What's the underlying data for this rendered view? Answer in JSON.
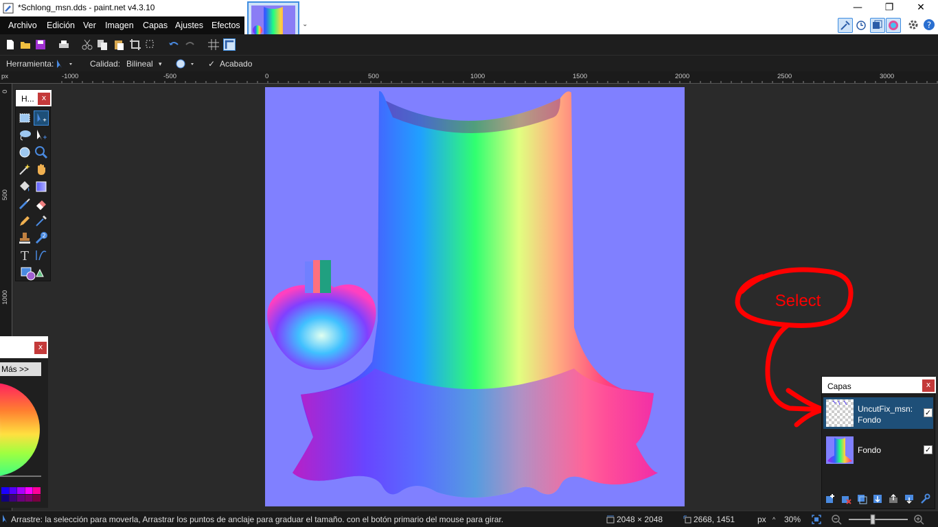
{
  "window": {
    "title": "*Schlong_msn.dds - paint.net v4.3.10",
    "minimize_glyph": "—",
    "maximize_glyph": "❐",
    "close_glyph": "✕"
  },
  "menu": {
    "items": [
      "Archivo",
      "Edición",
      "Ver",
      "Imagen",
      "Capas",
      "Ajustes",
      "Efectos"
    ]
  },
  "toolbar_options": {
    "tool_label": "Herramienta:",
    "quality_label": "Calidad:",
    "quality_value": "Bilineal",
    "finish_label": "Acabado"
  },
  "ruler": {
    "unit": "px",
    "top_ticks": [
      "-1000",
      "-500",
      "0",
      "500",
      "1000",
      "1500",
      "2000",
      "2500",
      "3000"
    ],
    "left_ticks": [
      "0",
      "500",
      "1000"
    ]
  },
  "tools_panel": {
    "title": "H...",
    "close": "x"
  },
  "colors_panel": {
    "close": "x",
    "more_button": "Más >>",
    "palette": [
      "#1a00ff",
      "#5500ff",
      "#aa00ff",
      "#ff00ff",
      "#ff0099",
      "#10007a",
      "#3d007a",
      "#6a007a",
      "#7a006a",
      "#7a0040"
    ]
  },
  "layers_panel": {
    "title": "Capas",
    "close": "x",
    "layers": [
      {
        "name_line1": "UncutFix_msn:",
        "name_line2": "Fondo",
        "visible": "✓"
      },
      {
        "name_line1": "Fondo",
        "visible": "✓"
      }
    ]
  },
  "annotation": {
    "text": "Select",
    "color": "#ff0000"
  },
  "statusbar": {
    "hint": "Arrastre: la selección para moverla, Arrastrar los puntos de anclaje para graduar el tamaño. con el botón primario del mouse para girar.",
    "image_size": "2048 × 2048",
    "cursor_pos": "2668, 1451",
    "unit": "px",
    "zoom": "30%"
  },
  "colors": {
    "accent": "#3d8ce0",
    "canvas_bg": "#8080ff",
    "selected_layer": "#1e4f78"
  }
}
